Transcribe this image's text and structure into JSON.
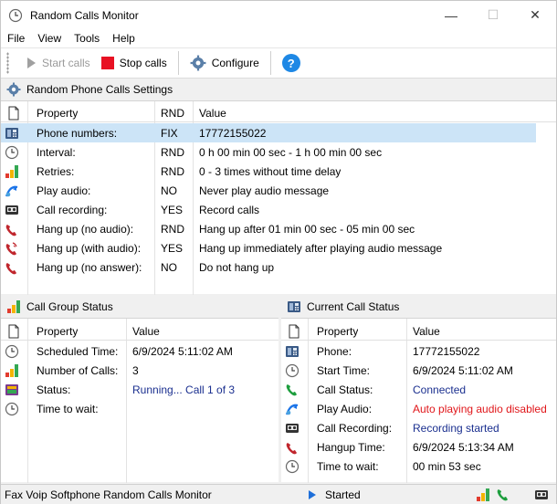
{
  "window": {
    "title": "Random Calls Monitor",
    "minimize": "—",
    "maximize": "☐",
    "close": "✕"
  },
  "menu": [
    "File",
    "View",
    "Tools",
    "Help"
  ],
  "toolbar": {
    "start_label": "Start calls",
    "stop_label": "Stop calls",
    "configure_label": "Configure",
    "help_label": "?"
  },
  "settings": {
    "title": "Random Phone Calls Settings",
    "headers": {
      "property": "Property",
      "rnd": "RND",
      "value": "Value"
    },
    "rows": [
      {
        "icon": "phone-icon",
        "property": "Phone numbers:",
        "rnd": "FIX",
        "value": "17772155022"
      },
      {
        "icon": "clock-icon",
        "property": "Interval:",
        "rnd": "RND",
        "value": "0 h 00 min 00 sec - 1 h 00 min 00 sec"
      },
      {
        "icon": "bars-icon",
        "property": "Retries:",
        "rnd": "RND",
        "value": "0 - 3 times without time delay"
      },
      {
        "icon": "audio-icon",
        "property": "Play audio:",
        "rnd": "NO",
        "value": "Never play audio message"
      },
      {
        "icon": "tape-icon",
        "property": "Call recording:",
        "rnd": "YES",
        "value": "Record calls"
      },
      {
        "icon": "hangup-icon",
        "property": "Hang up (no audio):",
        "rnd": "RND",
        "value": "Hang up after 01 min 00 sec - 05 min 00 sec"
      },
      {
        "icon": "hangup-audio-icon",
        "property": "Hang up (with audio):",
        "rnd": "YES",
        "value": "Hang up immediately after playing audio message"
      },
      {
        "icon": "hangup-icon",
        "property": "Hang up (no answer):",
        "rnd": "NO",
        "value": "Do not hang up"
      }
    ]
  },
  "group_status": {
    "title": "Call Group Status",
    "headers": {
      "property": "Property",
      "value": "Value"
    },
    "rows": [
      {
        "icon": "clock-icon",
        "property": "Scheduled Time:",
        "value": "6/9/2024 5:11:02 AM",
        "style": ""
      },
      {
        "icon": "bars-icon",
        "property": "Number of Calls:",
        "value": "3",
        "style": ""
      },
      {
        "icon": "status-icon",
        "property": "Status:",
        "value": "Running... Call 1 of 3",
        "style": "blue"
      },
      {
        "icon": "clock-icon",
        "property": "Time to wait:",
        "value": "",
        "style": ""
      }
    ]
  },
  "current_status": {
    "title": "Current Call Status",
    "headers": {
      "property": "Property",
      "value": "Value"
    },
    "rows": [
      {
        "icon": "phone-icon",
        "property": "Phone:",
        "value": "17772155022",
        "style": ""
      },
      {
        "icon": "clock-icon",
        "property": "Start Time:",
        "value": "6/9/2024 5:11:02 AM",
        "style": ""
      },
      {
        "icon": "handset-green-icon",
        "property": "Call Status:",
        "value": "Connected",
        "style": "blue"
      },
      {
        "icon": "audio-icon",
        "property": "Play Audio:",
        "value": "Auto playing audio disabled",
        "style": "red"
      },
      {
        "icon": "tape-icon",
        "property": "Call Recording:",
        "value": "Recording started",
        "style": "blue"
      },
      {
        "icon": "hangup-icon",
        "property": "Hangup Time:",
        "value": "6/9/2024 5:13:34 AM",
        "style": ""
      },
      {
        "icon": "clock-icon",
        "property": "Time to wait:",
        "value": "00 min 53 sec",
        "style": ""
      }
    ]
  },
  "statusbar": {
    "text": "Fax Voip Softphone Random Calls Monitor",
    "state": "Started"
  },
  "colors": {
    "selection": "#cce4f7",
    "stop_red": "#e81123",
    "help_blue": "#1e88e5",
    "status_blue": "#1a2f8f",
    "status_red": "#e0161a"
  }
}
